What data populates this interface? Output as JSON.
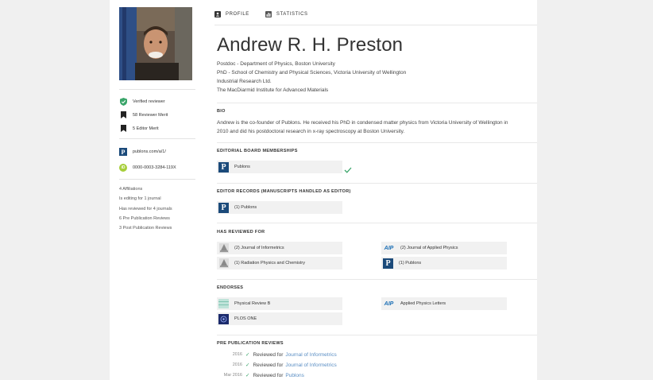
{
  "tabs": [
    {
      "label": "PROFILE",
      "icon": "profile-card-icon"
    },
    {
      "label": "STATISTICS",
      "icon": "bar-chart-icon"
    }
  ],
  "merits": [
    {
      "label": "Verified reviewer",
      "icon": "shield-check-icon",
      "color": "#3aa56a"
    },
    {
      "label": "58 Reviewer Merit",
      "icon": "bookmark-icon"
    },
    {
      "label": "5 Editor Merit",
      "icon": "bookmark-icon"
    }
  ],
  "links": {
    "publons": "publons.com/a/1/",
    "orcid_badge": "iD",
    "orcid": "0000-0003-3284-119X"
  },
  "stats": [
    "4 Affiliations",
    "Is editing for 1 journal",
    "Has reviewed for 4 journals",
    "6 Pre Publication Reviews",
    "3 Post Publication Reviews"
  ],
  "profile": {
    "name": "Andrew R. H. Preston",
    "affiliations": [
      "Postdoc - Department of Physics, Boston University",
      "PhD - School of Chemistry and Physical Sciences, Victoria University of Wellington",
      "Industrial Research Ltd.",
      "The MacDiarmid Institute for Advanced Materials"
    ]
  },
  "bio": {
    "title": "BIO",
    "text": "Andrew is the co-founder of Publons. He received his PhD in condensed matter physics from Victoria University of Wellington in 2010 and did his postdoctoral research in x-ray spectroscopy at Boston University."
  },
  "editorial": {
    "title": "EDITORIAL BOARD MEMBERSHIPS",
    "items": [
      {
        "label": "Publons",
        "logo": "publons-logo"
      }
    ]
  },
  "editor_records": {
    "title": "EDITOR RECORDS (MANUSCRIPTS HANDLED AS EDITOR)",
    "items": [
      {
        "label": "(1) Publons",
        "logo": "publons-logo"
      }
    ]
  },
  "reviewed_for": {
    "title": "HAS REVIEWED FOR",
    "items": [
      {
        "label": "(2) Journal of Informetrics",
        "logo": "elsevier-logo"
      },
      {
        "label": "(2) Journal of Applied Physics",
        "logo": "aip-logo"
      },
      {
        "label": "(1) Radiation Physics and Chemistry",
        "logo": "elsevier-logo"
      },
      {
        "label": "(1) Publons",
        "logo": "publons-logo"
      }
    ]
  },
  "endorses": {
    "title": "ENDORSES",
    "items": [
      {
        "label": "Physical Review B",
        "logo": "prb-logo"
      },
      {
        "label": "Applied Physics Letters",
        "logo": "aip-logo"
      },
      {
        "label": "PLOS ONE",
        "logo": "plos-logo"
      }
    ]
  },
  "pre_reviews": {
    "title": "PRE PUBLICATION REVIEWS",
    "items": [
      {
        "year": "2016",
        "text": "Reviewed for",
        "journal": "Journal of Informetrics"
      },
      {
        "year": "2016",
        "text": "Reviewed for",
        "journal": "Journal of Informetrics"
      },
      {
        "year": "Mar 2016",
        "text": "Reviewed for",
        "journal": "Publons"
      }
    ]
  },
  "logo_text": {
    "publons": "P",
    "aip": "AIP"
  },
  "colors": {
    "publons_blue": "#1b4a7a",
    "verified_green": "#3aa56a",
    "link_blue": "#5a8ec4",
    "orcid_green": "#a6ce39"
  }
}
